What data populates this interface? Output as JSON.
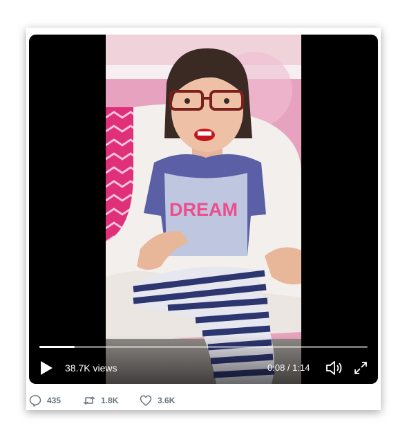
{
  "player": {
    "views": "38.7K views",
    "time": "0:08 / 1:14",
    "progress": 0.108,
    "video_caption_text": "DREAM"
  },
  "actions": {
    "replies": "435",
    "retweets": "1.8K",
    "likes": "3.6K"
  },
  "icons": {
    "play": "play-icon",
    "volume": "volume-icon",
    "fullscreen": "fullscreen-expand-icon",
    "reply": "reply-bubble-icon",
    "retweet": "retweet-icon",
    "like": "heart-icon"
  },
  "colors": {
    "action_text": "#66757f",
    "video_bg": "#000000",
    "wall": "#e9a6c3"
  }
}
